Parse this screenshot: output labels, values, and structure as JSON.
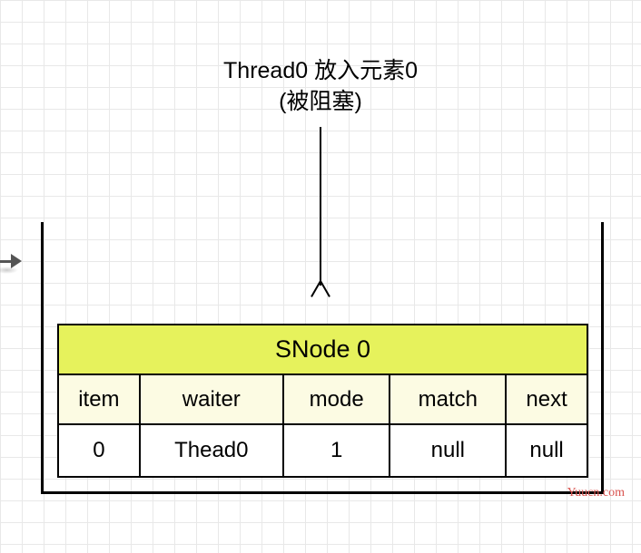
{
  "caption": {
    "line1": "Thread0 放入元素0",
    "line2": "(被阻塞)"
  },
  "node": {
    "title": "SNode 0",
    "columns": [
      "item",
      "waiter",
      "mode",
      "match",
      "next"
    ],
    "values": [
      "0",
      "Thead0",
      "1",
      "null",
      "null"
    ]
  },
  "watermark": "Yuucn.com",
  "chart_data": {
    "type": "table",
    "title": "SNode 0",
    "description": "Thread0 放入元素0 (被阻塞)",
    "columns": [
      "item",
      "waiter",
      "mode",
      "match",
      "next"
    ],
    "rows": [
      [
        "0",
        "Thead0",
        "1",
        "null",
        "null"
      ]
    ]
  }
}
